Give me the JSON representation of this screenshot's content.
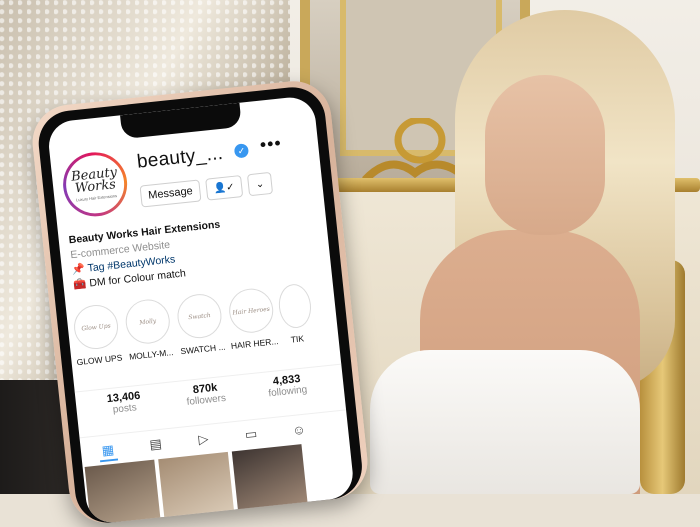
{
  "profile": {
    "username": "beauty_...",
    "logo_text": "Beauty Works",
    "logo_sub": "Luxury Hair Extensions",
    "verified_icon": "verified-badge-icon",
    "more_icon": "more-options-icon"
  },
  "buttons": {
    "message": "Message",
    "following": "👤✓",
    "dropdown": "⌄"
  },
  "bio": {
    "name": "Beauty Works Hair Extensions",
    "category": "E-commerce Website",
    "tag_line": "📌 Tag #BeautyWorks",
    "dm_line": "🧰 DM for Colour match"
  },
  "highlights": [
    {
      "label": "GLOW UPS",
      "cover": "Glow Ups"
    },
    {
      "label": "MOLLY-M...",
      "cover": "Molly"
    },
    {
      "label": "SWATCH ...",
      "cover": "Swatch"
    },
    {
      "label": "HAIR HER...",
      "cover": "Hair Heroes"
    },
    {
      "label": "TIK",
      "cover": ""
    }
  ],
  "stats": [
    {
      "value": "13,406",
      "label": "posts"
    },
    {
      "value": "870k",
      "label": "followers"
    },
    {
      "value": "4,833",
      "label": "following"
    }
  ],
  "tabs": [
    "grid-icon",
    "guides-icon",
    "reels-icon",
    "igtv-icon",
    "tagged-icon"
  ],
  "colors": {
    "accent": "#3897f0",
    "link": "#00376b",
    "muted": "#8e8e8e"
  }
}
